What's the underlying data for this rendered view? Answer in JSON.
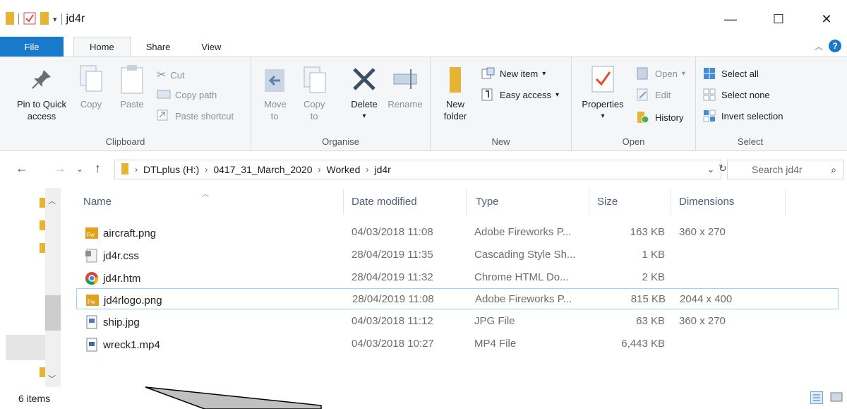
{
  "window": {
    "title": "jd4r",
    "minimize": "—",
    "maximize": "☐",
    "close": "✕"
  },
  "tabs": {
    "file": "File",
    "home": "Home",
    "share": "Share",
    "view": "View"
  },
  "ribbon": {
    "clipboard": {
      "label": "Clipboard",
      "pin": "Pin to Quick access",
      "copy": "Copy",
      "paste": "Paste",
      "cut": "Cut",
      "copy_path": "Copy path",
      "paste_shortcut": "Paste shortcut"
    },
    "organise": {
      "label": "Organise",
      "move_to": "Move to",
      "copy_to": "Copy to",
      "delete": "Delete",
      "rename": "Rename"
    },
    "new": {
      "label": "New",
      "new_folder": "New folder",
      "new_item": "New item",
      "easy_access": "Easy access"
    },
    "open": {
      "label": "Open",
      "properties": "Properties",
      "open": "Open",
      "edit": "Edit",
      "history": "History"
    },
    "select": {
      "label": "Select",
      "select_all": "Select all",
      "select_none": "Select none",
      "invert": "Invert selection"
    }
  },
  "address": {
    "crumbs": [
      "DTLplus (H:)",
      "0417_31_March_2020",
      "Worked",
      "jd4r"
    ],
    "search_placeholder": "Search jd4r"
  },
  "columns": {
    "name": "Name",
    "date": "Date modified",
    "type": "Type",
    "size": "Size",
    "dimensions": "Dimensions"
  },
  "files": [
    {
      "name": "aircraft.png",
      "date": "04/03/2018 11:08",
      "type": "Adobe Fireworks P...",
      "size": "163 KB",
      "dim": "360 x 270",
      "icon": "fireworks-icon"
    },
    {
      "name": "jd4r.css",
      "date": "28/04/2019 11:35",
      "type": "Cascading Style Sh...",
      "size": "1 KB",
      "dim": "",
      "icon": "css-file-icon"
    },
    {
      "name": "jd4r.htm",
      "date": "28/04/2019 11:32",
      "type": "Chrome HTML Do...",
      "size": "2 KB",
      "dim": "",
      "icon": "chrome-icon"
    },
    {
      "name": "jd4rlogo.png",
      "date": "28/04/2019 11:08",
      "type": "Adobe Fireworks P...",
      "size": "815 KB",
      "dim": "2044 x 400",
      "icon": "fireworks-icon"
    },
    {
      "name": "ship.jpg",
      "date": "04/03/2018 11:12",
      "type": "JPG File",
      "size": "63 KB",
      "dim": "360 x 270",
      "icon": "image-file-icon"
    },
    {
      "name": "wreck1.mp4",
      "date": "04/03/2018 10:27",
      "type": "MP4 File",
      "size": "6,443 KB",
      "dim": "",
      "icon": "video-file-icon"
    }
  ],
  "status": {
    "items": "6 items"
  },
  "colors": {
    "accent": "#1979ca",
    "selection_border": "#99d1ff",
    "folder": "#e7b332"
  }
}
